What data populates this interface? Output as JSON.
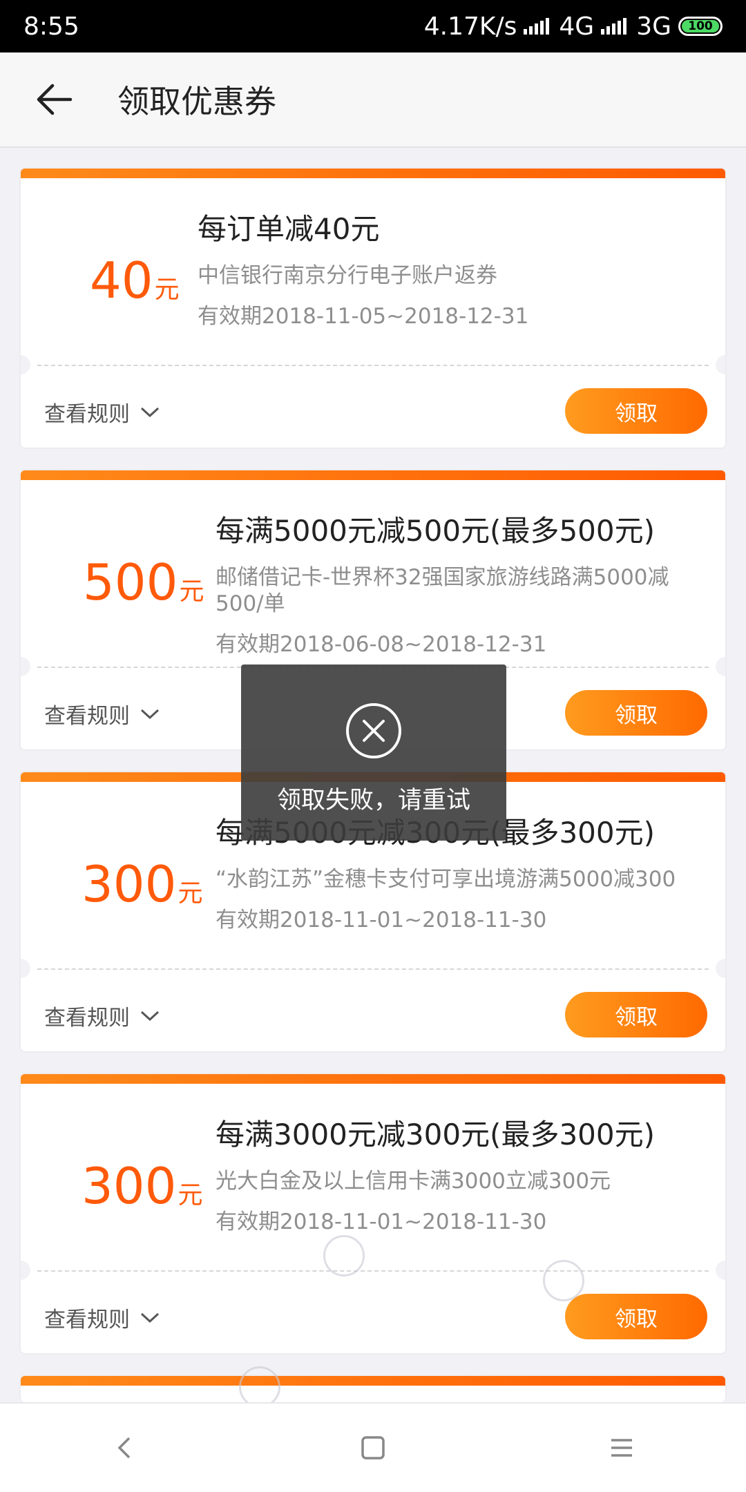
{
  "status_bar": {
    "time": "8:55",
    "speed": "4.17K/s",
    "network1": "4G",
    "network2": "3G",
    "battery": "100"
  },
  "header": {
    "title": "领取优惠券"
  },
  "coupons": [
    {
      "amount": "40",
      "unit": "元",
      "title": "每订单减40元",
      "desc": "中信银行南京分行电子账户返券",
      "valid": "有效期2018-11-05~2018-12-31",
      "rules_label": "查看规则",
      "claim_label": "领取"
    },
    {
      "amount": "500",
      "unit": "元",
      "title": "每满5000元减500元(最多500元)",
      "desc": "邮储借记卡-世界杯32强国家旅游线路满5000减500/单",
      "valid": "有效期2018-06-08~2018-12-31",
      "rules_label": "查看规则",
      "claim_label": "领取"
    },
    {
      "amount": "300",
      "unit": "元",
      "title": "每满5000元减300元(最多300元)",
      "desc": "“水韵江苏”金穗卡支付可享出境游满5000减300",
      "valid": "有效期2018-11-01~2018-11-30",
      "rules_label": "查看规则",
      "claim_label": "领取"
    },
    {
      "amount": "300",
      "unit": "元",
      "title": "每满3000元减300元(最多300元)",
      "desc": "光大白金及以上信用卡满3000立减300元",
      "valid": "有效期2018-11-01~2018-11-30",
      "rules_label": "查看规则",
      "claim_label": "领取"
    }
  ],
  "toast": {
    "message": "领取失败，请重试"
  },
  "colors": {
    "accent": "#ff5a0a",
    "button": "#ff7a00"
  }
}
